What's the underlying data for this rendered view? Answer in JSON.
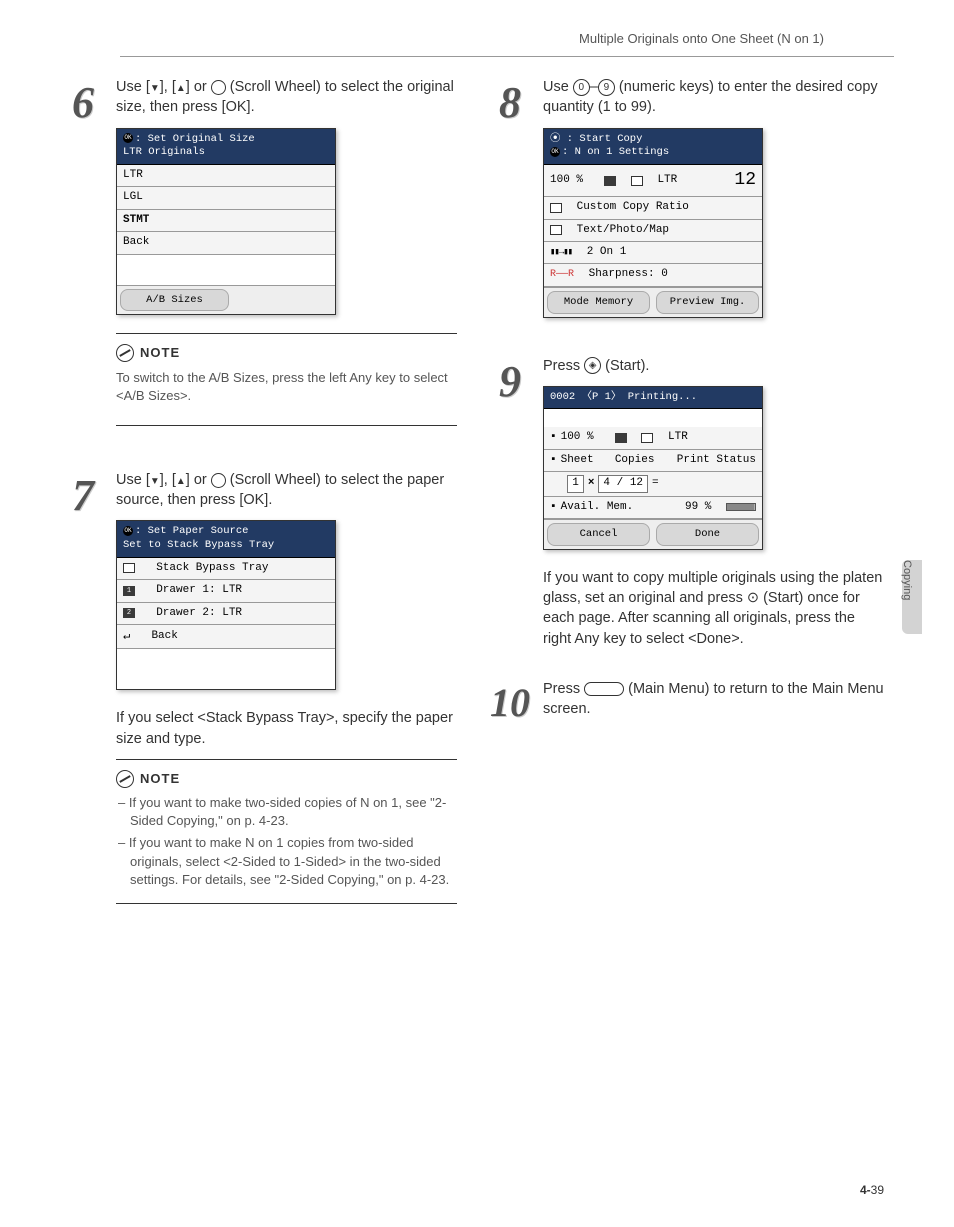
{
  "header": {
    "title": "Multiple Originals onto One Sheet (N on 1)"
  },
  "step6": {
    "num": "6",
    "text_a": "Use [",
    "text_b": "], [",
    "text_c": "] or ",
    "text_d": " (Scroll Wheel) to select the original size, then press [OK].",
    "lcd": {
      "line1": ": Set Original Size",
      "line2": "LTR Originals",
      "rows": [
        "LTR",
        "LGL",
        "STMT",
        "Back"
      ],
      "footer": "A/B Sizes"
    },
    "note": {
      "title": "NOTE",
      "text": "To switch to the A/B Sizes, press the left Any key to select <A/B Sizes>."
    }
  },
  "step7": {
    "num": "7",
    "text_a": "Use [",
    "text_b": "], [",
    "text_c": "] or ",
    "text_d": " (Scroll Wheel) to select the paper source, then press [OK].",
    "lcd": {
      "line1": ": Set Paper Source",
      "line2": "Set to Stack Bypass Tray",
      "rows": [
        {
          "icon": "tray",
          "label": "Stack Bypass Tray"
        },
        {
          "icon": "1",
          "label": "Drawer 1: LTR"
        },
        {
          "icon": "2",
          "label": "Drawer 2: LTR"
        },
        {
          "icon": "return",
          "label": "Back"
        }
      ]
    },
    "after": "If you select <Stack Bypass Tray>, specify the paper size and type.",
    "note": {
      "title": "NOTE",
      "items": [
        "If you want to make two-sided copies of N on 1, see \"2-Sided Copying,\" on p. 4-23.",
        "If you want to make N on 1 copies from two-sided originals, select <2-Sided to 1-Sided> in the two-sided settings. For details, see \"2-Sided Copying,\" on p. 4-23."
      ]
    }
  },
  "step8": {
    "num": "8",
    "text_a": "Use ",
    "key0": "0",
    "dash": "–",
    "key9": "9",
    "text_b": " (numeric keys) to enter the desired copy quantity (1 to 99).",
    "lcd": {
      "line1_a": "⦿ : Start Copy",
      "line1_b": ": N on 1 Settings",
      "ratio": "100 %",
      "ltr": "LTR",
      "qty": "12",
      "r2": "Custom Copy Ratio",
      "r3": "Text/Photo/Map",
      "r4": "2 On 1",
      "r5a": "R——R",
      "r5b": "Sharpness: 0",
      "f1": "Mode Memory",
      "f2": "Preview Img."
    }
  },
  "step9": {
    "num": "9",
    "text_a": "Press ",
    "text_b": " (Start).",
    "lcd": {
      "h": "0002 〈P   1〉  Printing...",
      "r1a": "100 %",
      "r1b": "LTR",
      "r2a": "Sheet",
      "r2b": "Copies",
      "r2c": "Print Status",
      "r3a": "1",
      "r3b": "4 / 12",
      "r4a": "Avail. Mem.",
      "r4b": "99 %",
      "f1": "Cancel",
      "f2": "Done"
    },
    "after": "If you want to copy multiple originals using the platen glass, set an original and press ⊙ (Start) once for each page. After scanning all originals, press the right Any key to select <Done>."
  },
  "step10": {
    "num": "10",
    "text_a": "Press ",
    "text_b": " (Main Menu) to return to the Main Menu screen."
  },
  "side": {
    "label": "Copying"
  },
  "pagenum": {
    "chapter": "4-",
    "page": "39"
  }
}
